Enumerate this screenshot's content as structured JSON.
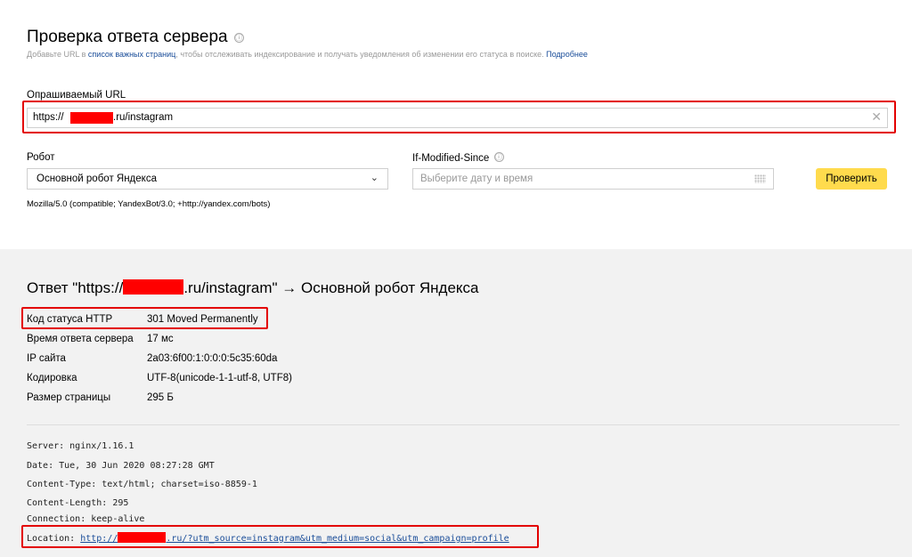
{
  "header": {
    "title": "Проверка ответа сервера",
    "info_icon": "ⓘ",
    "subtitle_prefix": "Добавьте URL в",
    "subtitle_link": "список важных страниц",
    "subtitle_middle": ", чтобы отслеживать индексирование и получать уведомления об изменении его статуса в поиске.",
    "subtitle_more": "Подробнее"
  },
  "form": {
    "url_label": "Опрашиваемый URL",
    "url_prefix": "https://",
    "url_suffix": ".ru/instagram",
    "clear_glyph": "✕",
    "robot_label": "Робот",
    "robot_value": "Основной робот Яндекса",
    "robot_chevron": "⌄",
    "user_agent": "Mozilla/5.0 (compatible; YandexBot/3.0; +http://yandex.com/bots)",
    "ims_label": "If-Modified-Since",
    "ims_placeholder": "Выберите дату и время",
    "check_button": "Проверить"
  },
  "response": {
    "title_prefix": "Ответ \"https://",
    "title_suffix": ".ru/instagram\" → Основной робот Яндекса",
    "rows": [
      {
        "label": "Код статуса HTTP",
        "value": "301 Moved Permanently"
      },
      {
        "label": "Время ответа сервера",
        "value": "17 мс"
      },
      {
        "label": "IP сайта",
        "value": "2a03:6f00:1:0:0:0:5c35:60da"
      },
      {
        "label": "Кодировка",
        "value": "UTF-8(unicode-1-1-utf-8, UTF8)"
      },
      {
        "label": "Размер страницы",
        "value": "295 Б"
      }
    ],
    "headers": [
      "Server: nginx/1.16.1",
      "Date: Tue, 30 Jun 2020 08:27:28 GMT",
      "Content-Type: text/html; charset=iso-8859-1",
      "Content-Length: 295",
      "Connection: keep-alive"
    ],
    "location_label": "Location: ",
    "location_prefix": "http://",
    "location_suffix": ".ru/?utm_source=instagram&utm_medium=social&utm_campaign=profile"
  },
  "colors": {
    "highlight": "#e30000",
    "link": "#1a4d99",
    "button": "#ffdb4d",
    "result_bg": "#f2f2f2"
  }
}
